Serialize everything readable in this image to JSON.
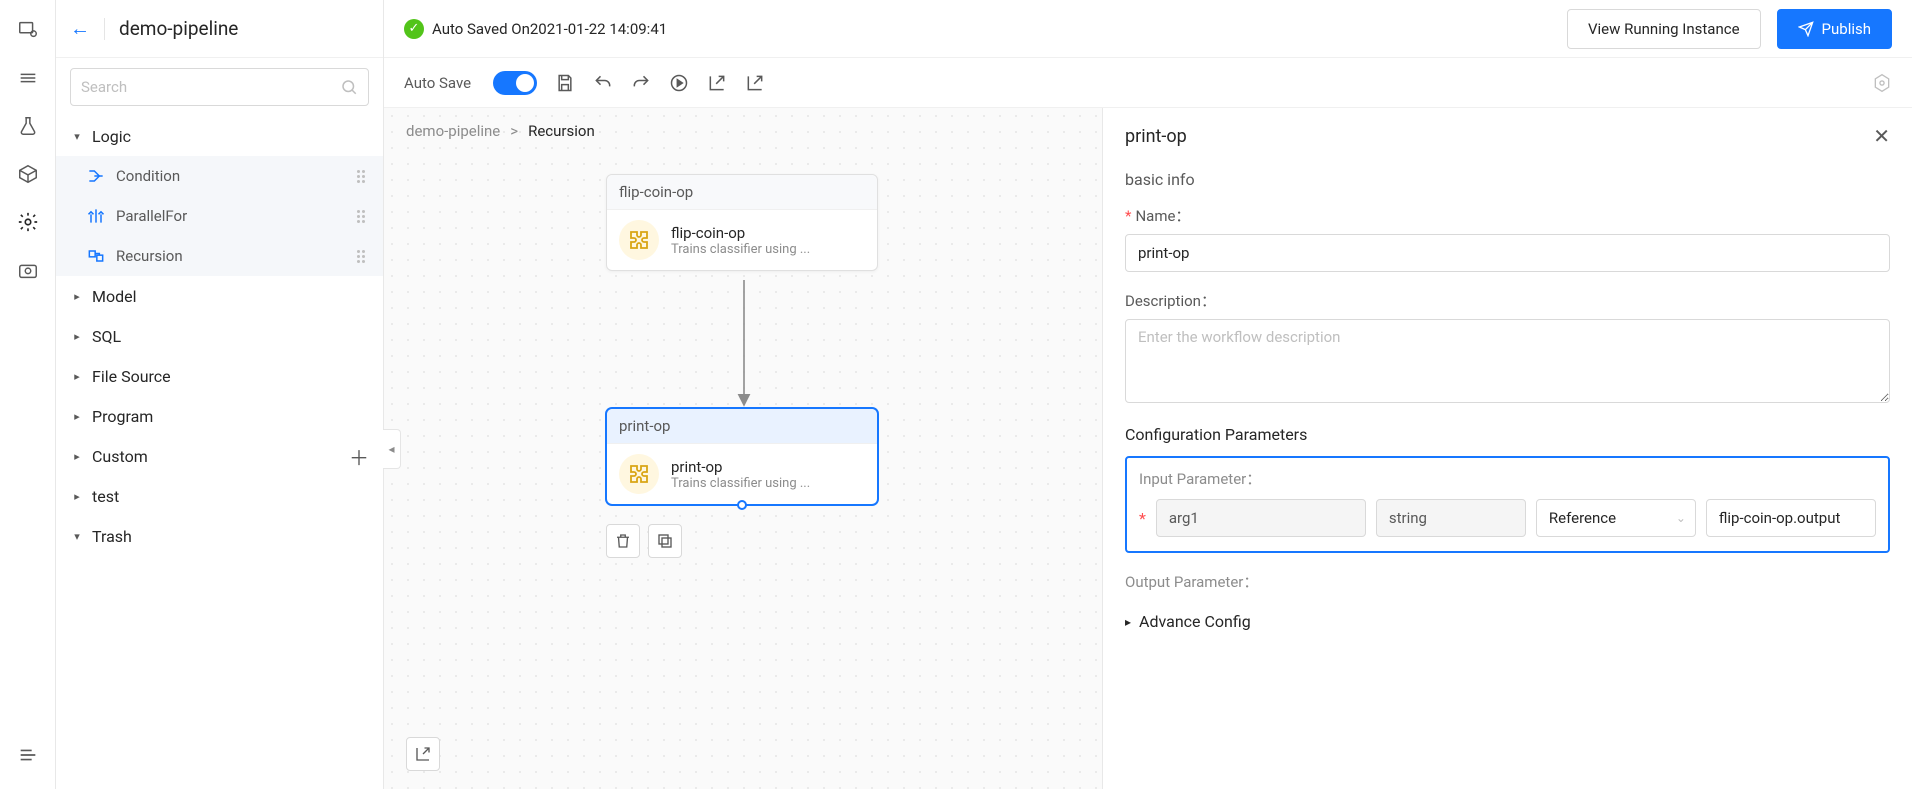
{
  "header": {
    "title": "demo-pipeline",
    "auto_saved": "Auto Saved On2021-01-22 14:09:41",
    "view_running": "View Running Instance",
    "publish": "Publish"
  },
  "toolbar": {
    "auto_save_label": "Auto Save"
  },
  "search": {
    "placeholder": "Search"
  },
  "tree": {
    "groups": [
      {
        "label": "Logic",
        "expanded": true,
        "items": [
          {
            "label": "Condition"
          },
          {
            "label": "ParallelFor"
          },
          {
            "label": "Recursion"
          }
        ]
      },
      {
        "label": "Model",
        "expanded": false
      },
      {
        "label": "SQL",
        "expanded": false
      },
      {
        "label": "File Source",
        "expanded": false
      },
      {
        "label": "Program",
        "expanded": false
      },
      {
        "label": "Custom",
        "expanded": false,
        "plus": true
      },
      {
        "label": "test",
        "expanded": false
      },
      {
        "label": "Trash",
        "expanded": true
      }
    ]
  },
  "breadcrumb": {
    "root": "demo-pipeline",
    "sep": ">",
    "current": "Recursion"
  },
  "nodes": {
    "n1": {
      "header": "flip-coin-op",
      "title": "flip-coin-op",
      "sub": "Trains classifier using ..."
    },
    "n2": {
      "header": "print-op",
      "title": "print-op",
      "sub": "Trains classifier using ..."
    }
  },
  "panel": {
    "title": "print-op",
    "basic_info": "basic info",
    "name_label": "Name：",
    "name_value": "print-op",
    "desc_label": "Description：",
    "desc_placeholder": "Enter the workflow description",
    "config_title": "Configuration Parameters",
    "input_param_label": "Input Parameter：",
    "arg_name": "arg1",
    "arg_type": "string",
    "ref_label": "Reference",
    "ref_value": "flip-coin-op.output",
    "output_param_label": "Output Parameter：",
    "advance": "Advance Config"
  }
}
